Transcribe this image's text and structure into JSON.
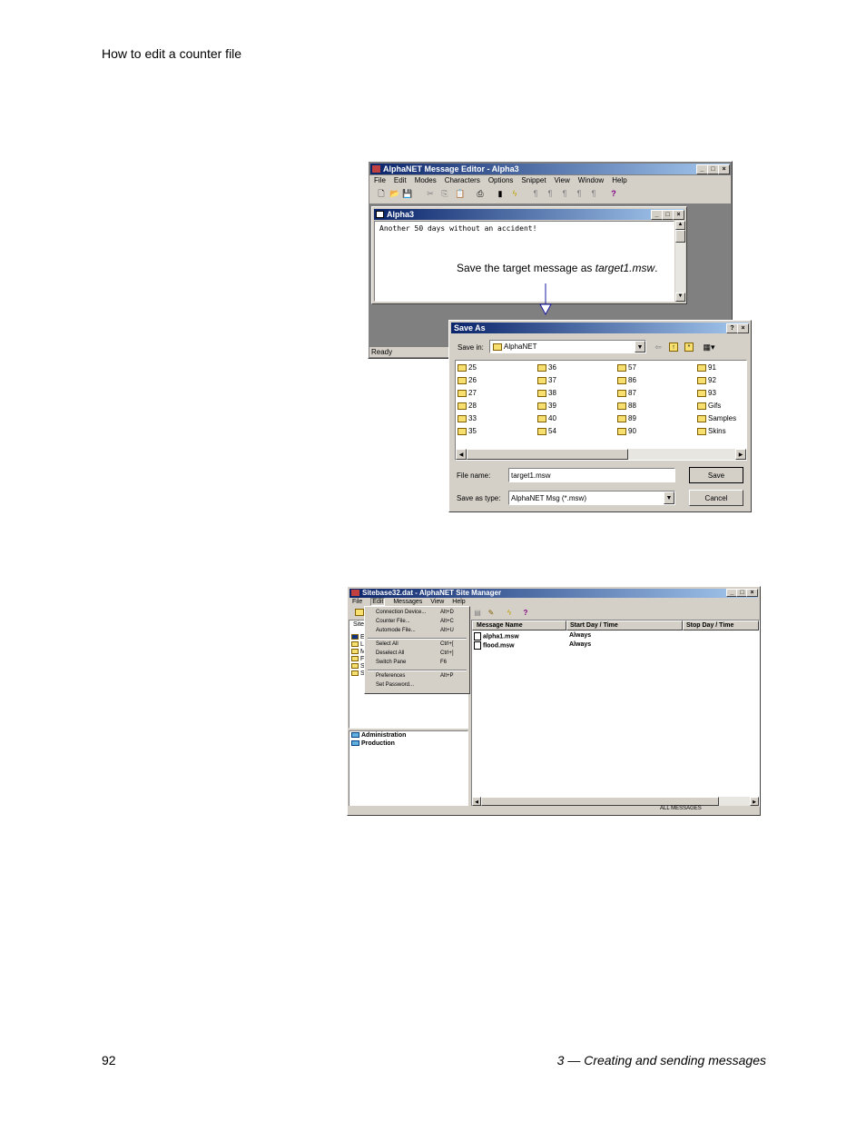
{
  "page": {
    "header": "How to edit a counter file",
    "page_number": "92",
    "chapter": "3 — Creating and sending messages"
  },
  "editor": {
    "title": "AlphaNET Message Editor - Alpha3",
    "menu": [
      "File",
      "Edit",
      "Modes",
      "Characters",
      "Options",
      "Snippet",
      "View",
      "Window",
      "Help"
    ],
    "child_title": "Alpha3",
    "message_text": "Another 50 days without an accident!",
    "status": "Ready",
    "callout_prefix": "Save the target message as ",
    "callout_file": "target1.msw",
    "callout_suffix": "."
  },
  "save_as": {
    "title": "Save As",
    "save_in_label": "Save in:",
    "save_in_value": "AlphaNET",
    "folders_col1": [
      "25",
      "26",
      "27",
      "28",
      "33",
      "35"
    ],
    "folders_col2": [
      "36",
      "37",
      "38",
      "39",
      "40",
      "54"
    ],
    "folders_col3": [
      "57",
      "86",
      "87",
      "88",
      "89",
      "90"
    ],
    "folders_col4": [
      "91",
      "92",
      "93",
      "Gifs",
      "Samples",
      "Skins"
    ],
    "file_name_label": "File name:",
    "file_name_value": "target1.msw",
    "save_type_label": "Save as type:",
    "save_type_value": "AlphaNET Msg (*.msw)",
    "save_button": "Save",
    "cancel_button": "Cancel"
  },
  "site_manager": {
    "title": "Sitebase32.dat - AlphaNET Site Manager",
    "menu": [
      "File",
      "Edit",
      "Messages",
      "View",
      "Help"
    ],
    "edit_menu": [
      {
        "label": "Connection Device...",
        "shortcut": "Alt+D"
      },
      {
        "label": "Counter File...",
        "shortcut": "Alt+C"
      },
      {
        "label": "Automode File...",
        "shortcut": "Alt+U"
      },
      {
        "label": "Select All",
        "shortcut": "Ctrl+["
      },
      {
        "label": "Deselect All",
        "shortcut": "Ctrl+]"
      },
      {
        "label": "Switch Pane",
        "shortcut": "F6"
      },
      {
        "label": "Preferences",
        "shortcut": "Alt+P"
      },
      {
        "label": "Set Password...",
        "shortcut": ""
      }
    ],
    "left_header_fragment": "Site",
    "tree_fragments": [
      "E",
      "L",
      "M",
      "F",
      "S",
      "S"
    ],
    "groups": [
      "Administration",
      "Production"
    ],
    "columns": [
      "Message Name",
      "Start Day / Time",
      "Stop Day / Time"
    ],
    "rows": [
      {
        "name": "alpha1.msw",
        "start": "Always"
      },
      {
        "name": "flood.msw",
        "start": "Always"
      }
    ],
    "status": "ALL MESSAGES"
  }
}
